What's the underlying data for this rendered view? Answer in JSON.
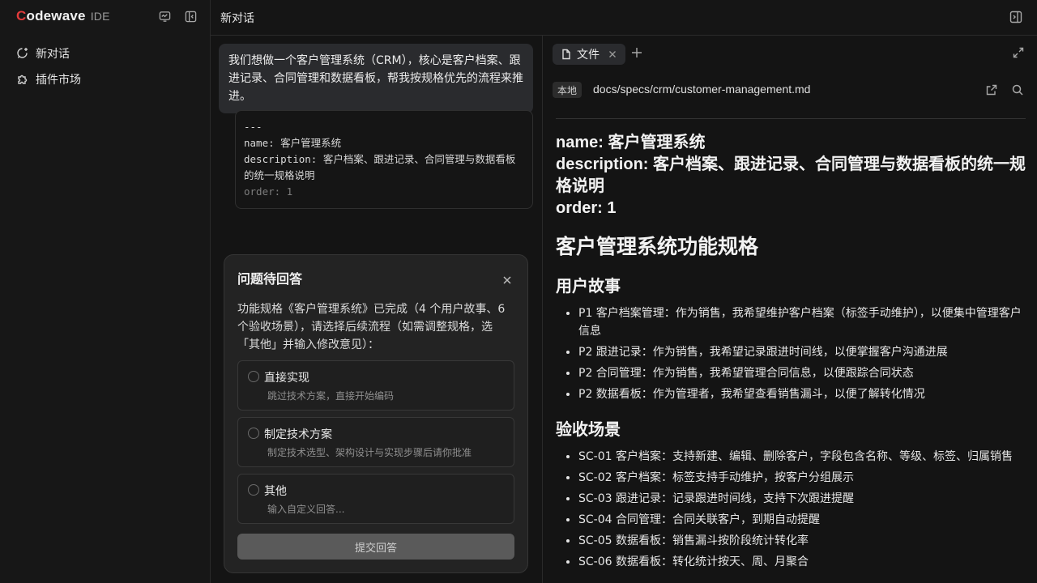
{
  "sidebar": {
    "logo": {
      "first": "C",
      "rest": "odewave",
      "suffix": "IDE"
    },
    "items": [
      {
        "label": "新对话",
        "icon": "new-chat-icon"
      },
      {
        "label": "插件市场",
        "icon": "puzzle-icon"
      }
    ]
  },
  "topbar": {
    "title": "新对话"
  },
  "chat": {
    "user_message": "我们想做一个客户管理系统（CRM），核心是客户档案、跟进记录、合同管理和数据看板，帮我按规格优先的流程来推进。",
    "code_lines": [
      "---",
      "name: 客户管理系统",
      "description: 客户档案、跟进记录、合同管理与数据看板的统一规格说明",
      "order: 1"
    ]
  },
  "question": {
    "title": "问题待回答",
    "description": "功能规格《客户管理系统》已完成（4 个用户故事、6 个验收场景），请选择后续流程（如需调整规格，选「其他」并输入修改意见）：",
    "options": [
      {
        "label": "直接实现",
        "sub": "跳过技术方案，直接开始编码"
      },
      {
        "label": "制定技术方案",
        "sub": "制定技术选型、架构设计与实现步骤后请你批准"
      },
      {
        "label": "其他",
        "sub": "输入自定义回答..."
      }
    ],
    "submit_label": "提交回答"
  },
  "doc": {
    "tab_label": "文件",
    "badge": "本地",
    "path": "docs/specs/crm/customer-management.md",
    "frontmatter": [
      "name: 客户管理系统",
      "description: 客户档案、跟进记录、合同管理与数据看板的统一规格说明",
      "order: 1"
    ],
    "h1": "客户管理系统功能规格",
    "stories_heading": "用户故事",
    "stories": [
      "P1 客户档案管理：作为销售，我希望维护客户档案（标签手动维护），以便集中管理客户信息",
      "P2 跟进记录：作为销售，我希望记录跟进时间线，以便掌握客户沟通进展",
      "P2 合同管理：作为销售，我希望管理合同信息，以便跟踪合同状态",
      "P2 数据看板：作为管理者，我希望查看销售漏斗，以便了解转化情况"
    ],
    "scenarios_heading": "验收场景",
    "scenarios": [
      "SC-01 客户档案：支持新建、编辑、删除客户，字段包含名称、等级、标签、归属销售",
      "SC-02 客户档案：标签支持手动维护，按客户分组展示",
      "SC-03 跟进记录：记录跟进时间线，支持下次跟进提醒",
      "SC-04 合同管理：合同关联客户，到期自动提醒",
      "SC-05 数据看板：销售漏斗按阶段统计转化率",
      "SC-06 数据看板：转化统计按天、周、月聚合"
    ]
  }
}
